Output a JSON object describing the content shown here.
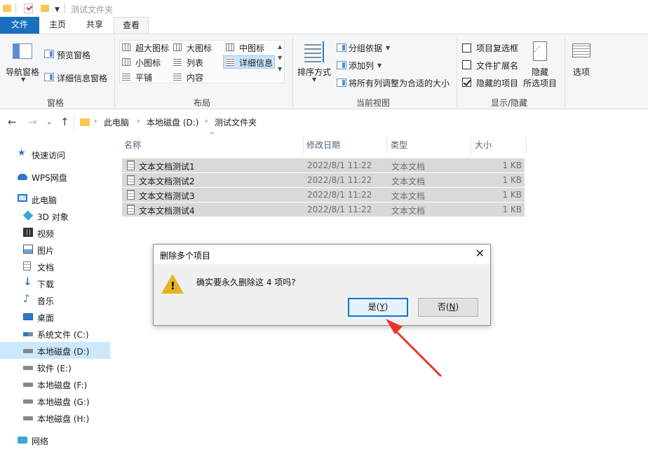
{
  "window": {
    "title": "测试文件夹"
  },
  "ribbon_tabs": {
    "file": "文件",
    "home": "主页",
    "share": "共享",
    "view": "查看"
  },
  "ribbon": {
    "panes": {
      "nav_pane": "导航窗格",
      "preview_pane": "预览窗格",
      "details_pane": "详细信息窗格",
      "group_label": "窗格"
    },
    "layout": {
      "extra_large_icons": "超大图标",
      "large_icons": "大图标",
      "medium_icons": "中图标",
      "small_icons": "小图标",
      "list": "列表",
      "details": "详细信息",
      "tiles": "平铺",
      "content": "内容",
      "group_label": "布局",
      "selected": "详细信息"
    },
    "current_view": {
      "sort_by": "排序方式",
      "group_by": "分组依据",
      "add_columns": "添加列",
      "size_all_columns": "将所有列调整为合适的大小",
      "group_label": "当前视图"
    },
    "show_hide": {
      "item_checkboxes": "项目复选框",
      "item_checkboxes_checked": false,
      "file_extensions": "文件扩展名",
      "file_extensions_checked": false,
      "hidden_items": "隐藏的项目",
      "hidden_items_checked": true,
      "hide_selected_line1": "隐藏",
      "hide_selected_line2": "所选项目",
      "group_label": "显示/隐藏"
    },
    "options": "选项"
  },
  "address": {
    "crumbs": [
      "此电脑",
      "本地磁盘 (D:)",
      "测试文件夹"
    ]
  },
  "sidebar": {
    "items": [
      {
        "label": "快速访问",
        "icon": "star-icon"
      },
      {
        "label": "WPS网盘",
        "icon": "cloud-icon"
      },
      {
        "label": "此电脑",
        "icon": "computer-icon"
      },
      {
        "label": "3D 对象",
        "icon": "cube-icon"
      },
      {
        "label": "视频",
        "icon": "video-icon"
      },
      {
        "label": "图片",
        "icon": "picture-icon"
      },
      {
        "label": "文档",
        "icon": "document-icon"
      },
      {
        "label": "下载",
        "icon": "download-icon"
      },
      {
        "label": "音乐",
        "icon": "music-icon"
      },
      {
        "label": "桌面",
        "icon": "desktop-icon"
      },
      {
        "label": "系统文件 (C:)",
        "icon": "system-drive-icon"
      },
      {
        "label": "本地磁盘 (D:)",
        "icon": "drive-icon",
        "selected": true
      },
      {
        "label": "软件 (E:)",
        "icon": "drive-icon"
      },
      {
        "label": "本地磁盘 (F:)",
        "icon": "drive-icon"
      },
      {
        "label": "本地磁盘 (G:)",
        "icon": "drive-icon"
      },
      {
        "label": "本地磁盘 (H:)",
        "icon": "drive-icon"
      },
      {
        "label": "网络",
        "icon": "network-icon"
      }
    ]
  },
  "filelist": {
    "columns": {
      "name": "名称",
      "date": "修改日期",
      "type": "类型",
      "size": "大小"
    },
    "rows": [
      {
        "name": "文本文档测试1",
        "date": "2022/8/1 11:22",
        "type": "文本文档",
        "size": "1 KB"
      },
      {
        "name": "文本文档测试2",
        "date": "2022/8/1 11:22",
        "type": "文本文档",
        "size": "1 KB"
      },
      {
        "name": "文本文档测试3",
        "date": "2022/8/1 11:22",
        "type": "文本文档",
        "size": "1 KB"
      },
      {
        "name": "文本文档测试4",
        "date": "2022/8/1 11:22",
        "type": "文本文档",
        "size": "1 KB"
      }
    ]
  },
  "dialog": {
    "title": "删除多个项目",
    "message": "确实要永久删除这 4 项吗?",
    "yes_label": "是",
    "yes_key": "Y",
    "no_label": "否",
    "no_key": "N"
  },
  "colors": {
    "accent": "#1a6fbf",
    "selection": "#cce8ff",
    "annotation_arrow": "#e8362b"
  }
}
